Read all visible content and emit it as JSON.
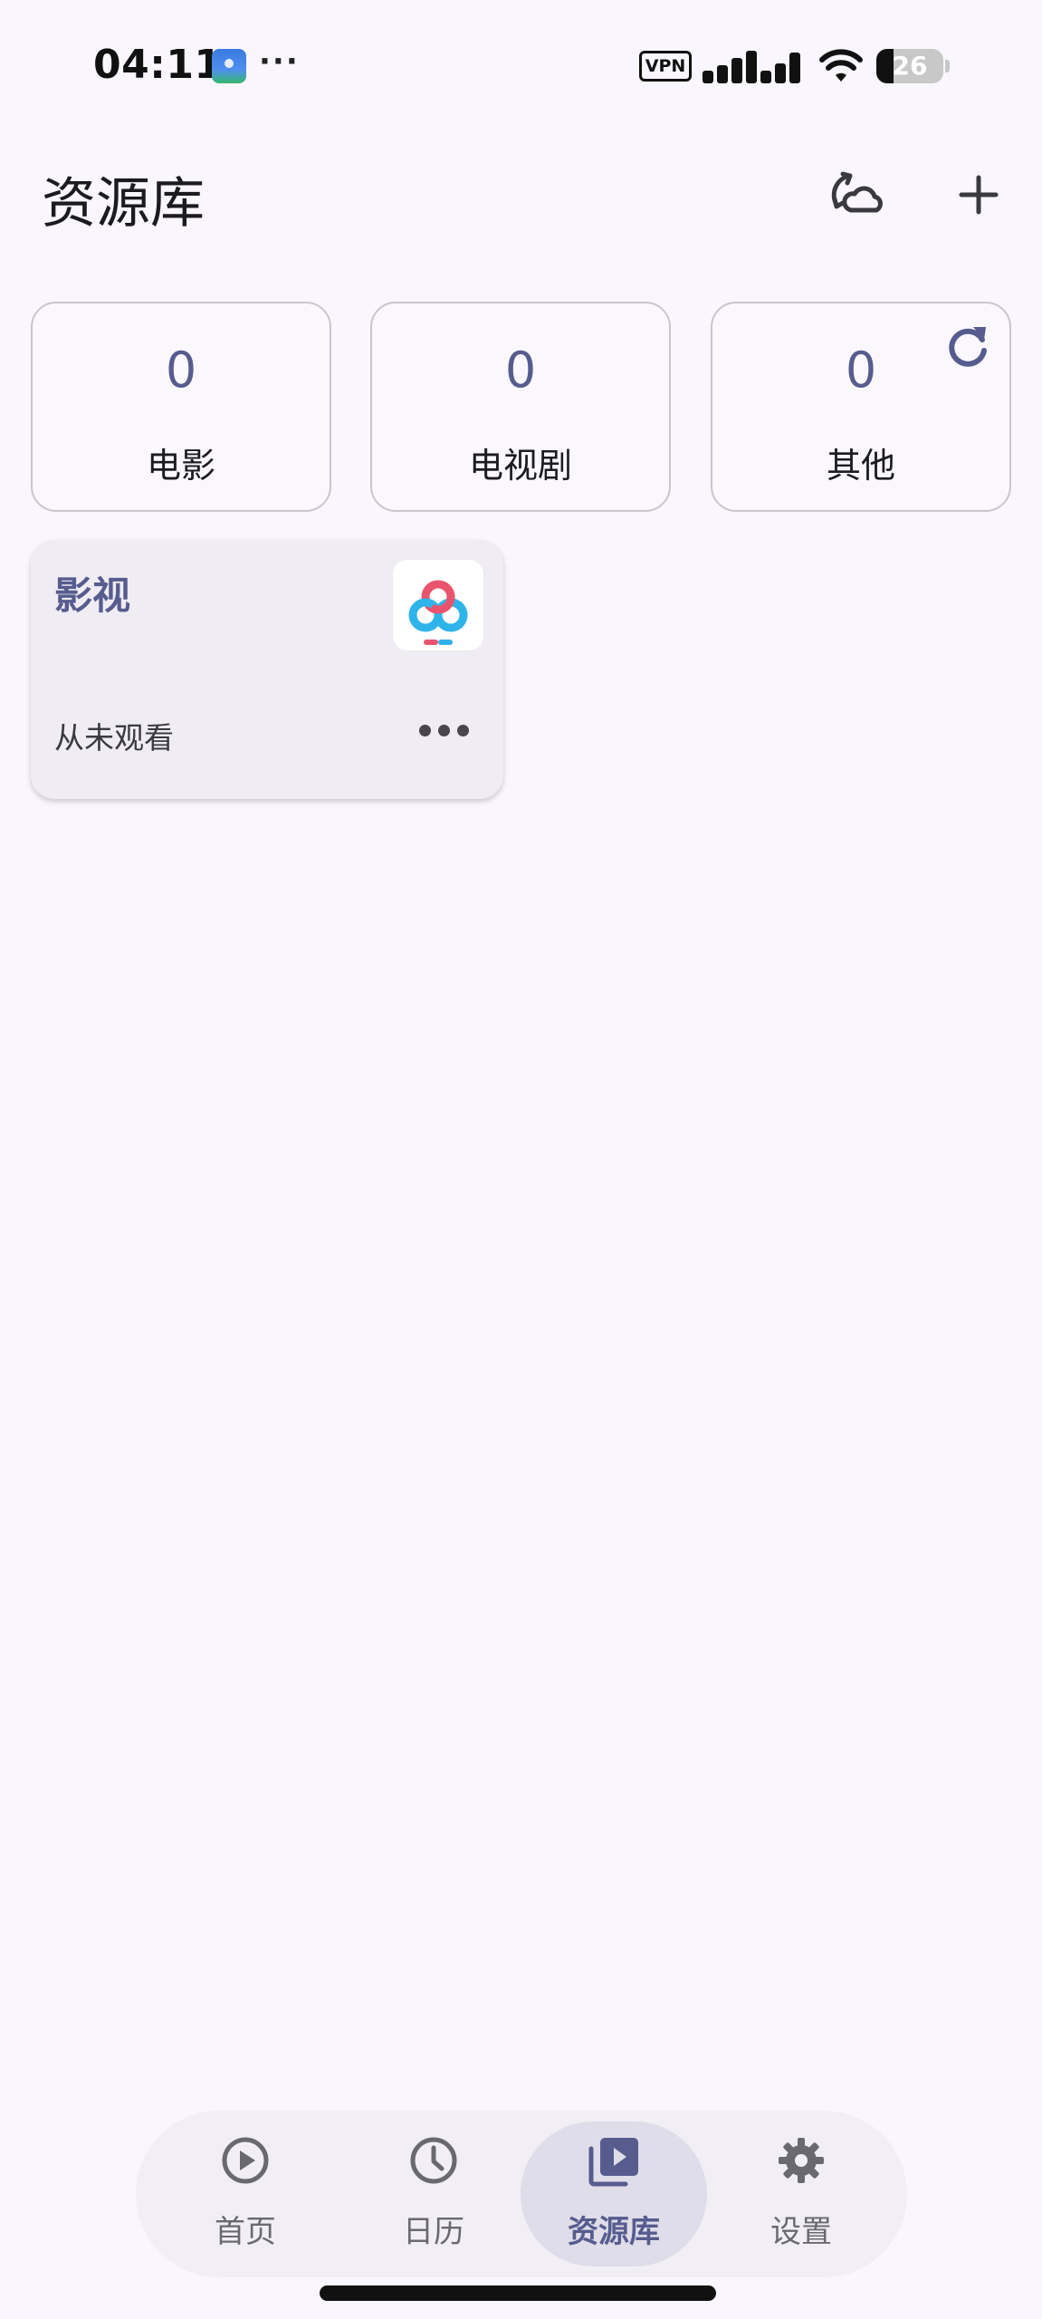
{
  "status_bar": {
    "time": "04:11",
    "dots": "···",
    "vpn": "VPN",
    "battery": "26",
    "battery_level": 0.26
  },
  "header": {
    "title": "资源库",
    "sync_icon": "cloud-sync-icon",
    "add_icon": "plus-icon"
  },
  "stats": [
    {
      "count": "0",
      "label": "电影"
    },
    {
      "count": "0",
      "label": "电视剧"
    },
    {
      "count": "0",
      "label": "其他"
    }
  ],
  "library": {
    "title": "影视",
    "status": "从未观看",
    "logo_icon": "cloud-drive-logo-icon"
  },
  "nav": {
    "items": [
      {
        "label": "首页",
        "icon": "play-circle-icon"
      },
      {
        "label": "日历",
        "icon": "clock-icon"
      },
      {
        "label": "资源库",
        "icon": "video-library-icon",
        "active": true
      },
      {
        "label": "设置",
        "icon": "gear-icon"
      }
    ]
  },
  "colors": {
    "accent": "#565c8e",
    "background": "#f9f6fd",
    "nav_bg": "#f1eef5",
    "nav_active_pill": "#dfdde9"
  }
}
